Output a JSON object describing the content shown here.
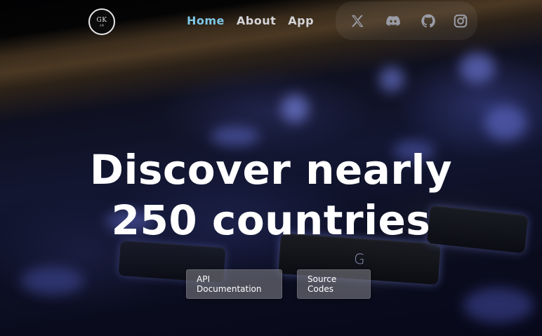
{
  "brand": {
    "logo_text": "GK",
    "logo_subtext": "API",
    "logo_ring_color": "#e6e6e6"
  },
  "nav": {
    "links": [
      {
        "label": "Home",
        "active": true
      },
      {
        "label": "About",
        "active": false
      },
      {
        "label": "App",
        "active": false
      }
    ],
    "active_color": "#7dc6e6",
    "inactive_color": "#d4d4d8"
  },
  "social": {
    "icons": [
      "x-icon",
      "discord-icon",
      "github-icon",
      "instagram-icon"
    ],
    "icon_color": "#9a9ca6"
  },
  "hero": {
    "headline_line1": "Discover nearly",
    "headline_line2": "250 countries",
    "background": "blurred-keyboard-photo",
    "key_glyph": "G"
  },
  "actions": {
    "api_docs_label": "API Documentation",
    "source_codes_label": "Source Codes"
  }
}
